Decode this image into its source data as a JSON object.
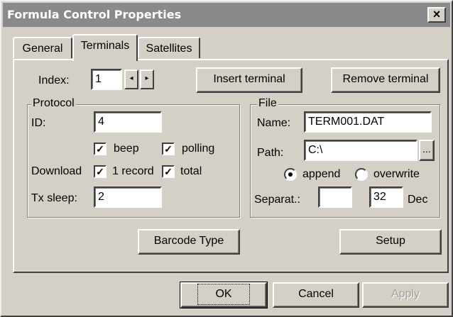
{
  "window": {
    "title": "Formula Control Properties",
    "close_glyph": "×"
  },
  "tabs": [
    {
      "label": "General"
    },
    {
      "label": "Terminals"
    },
    {
      "label": "Satellites"
    }
  ],
  "index": {
    "label": "Index:",
    "value": "1",
    "prev_glyph": "◂",
    "next_glyph": "▸"
  },
  "terminal_buttons": {
    "insert": "Insert terminal",
    "remove": "Remove terminal"
  },
  "protocol": {
    "group_label": "Protocol",
    "id_label": "ID:",
    "id_value": "4",
    "beep_label": "beep",
    "beep_checked": true,
    "polling_label": "polling",
    "polling_checked": true,
    "download_label": "Download",
    "one_record_label": "1 record",
    "one_record_checked": true,
    "total_label": "total",
    "total_checked": true,
    "tx_sleep_label": "Tx sleep:",
    "tx_sleep_value": "2",
    "check_glyph": "✓"
  },
  "file": {
    "group_label": "File",
    "name_label": "Name:",
    "name_value": "TERM001.DAT",
    "path_label": "Path:",
    "path_value": "C:\\",
    "browse_label": "...",
    "append_label": "append",
    "overwrite_label": "overwrite",
    "mode_selected": "append",
    "separator_label": "Separat.:",
    "separator_char": "",
    "separator_code": "32",
    "separator_unit": "Dec"
  },
  "panel_buttons": {
    "barcode_type": "Barcode Type",
    "setup": "Setup"
  },
  "dialog_buttons": {
    "ok": "OK",
    "cancel": "Cancel",
    "apply": "Apply"
  }
}
